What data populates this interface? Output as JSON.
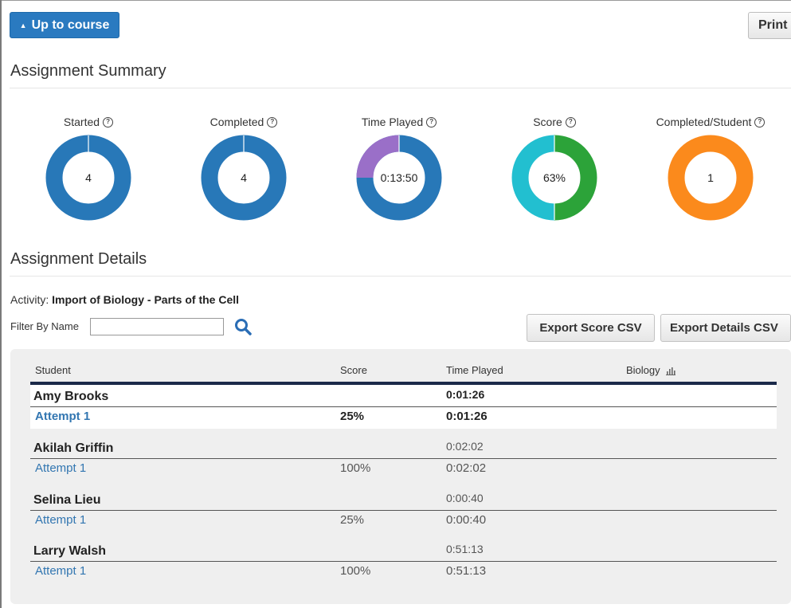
{
  "header": {
    "up_label": "Up to course",
    "print_label": "Print"
  },
  "summary": {
    "title": "Assignment Summary",
    "metrics": [
      {
        "label": "Started",
        "value": "4"
      },
      {
        "label": "Completed",
        "value": "4"
      },
      {
        "label": "Time Played",
        "value": "0:13:50"
      },
      {
        "label": "Score",
        "value": "63%"
      },
      {
        "label": "Completed/Student",
        "value": "1"
      }
    ]
  },
  "details": {
    "title": "Assignment Details",
    "activity_prefix": "Activity:",
    "activity_name": "Import of Biology - Parts of the Cell",
    "filter_label": "Filter By Name",
    "filter_value": "",
    "export_score_label": "Export Score CSV",
    "export_details_label": "Export Details CSV"
  },
  "table": {
    "columns": [
      "Student",
      "Score",
      "Time Played",
      "Biology"
    ],
    "students": [
      {
        "name": "Amy Brooks",
        "time": "0:01:26",
        "attempt": {
          "label": "Attempt 1",
          "score": "25%",
          "time": "0:01:26"
        }
      },
      {
        "name": "Akilah Griffin",
        "time": "0:02:02",
        "attempt": {
          "label": "Attempt 1",
          "score": "100%",
          "time": "0:02:02"
        }
      },
      {
        "name": "Selina Lieu",
        "time": "0:00:40",
        "attempt": {
          "label": "Attempt 1",
          "score": "25%",
          "time": "0:00:40"
        }
      },
      {
        "name": "Larry Walsh",
        "time": "0:51:13",
        "attempt": {
          "label": "Attempt 1",
          "score": "100%",
          "time": "0:51:13"
        }
      }
    ]
  },
  "colors": {
    "primary": "#2a7ac0",
    "donut_blue": "#2878b8",
    "time_purple": "#9a6fc8",
    "score_cyan": "#22bfd0",
    "score_green": "#2ca339",
    "completed_orange": "#fb8a1c",
    "link": "#3276b1",
    "header_rule": "#1b2a4a"
  }
}
